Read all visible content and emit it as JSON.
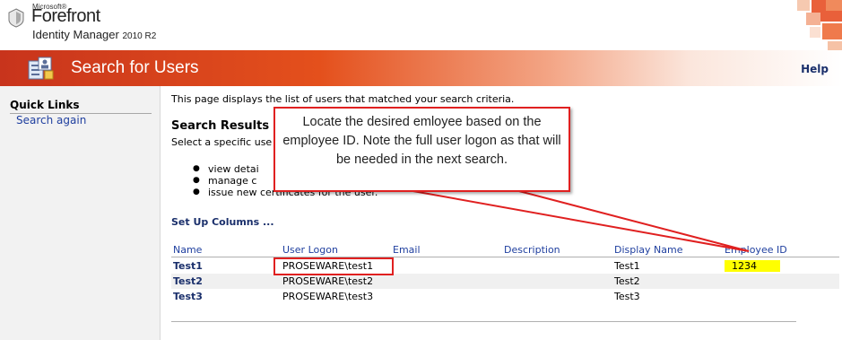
{
  "branding": {
    "microsoft": "Microsoft®",
    "product": "Forefront",
    "product_line": "Identity Manager",
    "version": "2010 R2"
  },
  "title_bar": {
    "title": "Search for Users",
    "help": "Help"
  },
  "sidebar": {
    "quick_links_title": "Quick Links",
    "links": [
      {
        "label": "Search again"
      }
    ]
  },
  "main": {
    "intro": "This page displays the list of users that matched your search criteria.",
    "results_heading": "Search Results",
    "results_instruction": "Select a specific use",
    "bullets": [
      "view detai",
      "manage c",
      "issue new certificates for the user."
    ],
    "setup_columns": "Set Up Columns ...",
    "table": {
      "columns": [
        "Name",
        "User Logon",
        "Email",
        "Description",
        "Display Name",
        "Employee ID"
      ],
      "rows": [
        {
          "name": "Test1",
          "user_logon": "PROSEWARE\\test1",
          "email": "",
          "description": "",
          "display_name": "Test1",
          "employee_id": "1234"
        },
        {
          "name": "Test2",
          "user_logon": "PROSEWARE\\test2",
          "email": "",
          "description": "",
          "display_name": "Test2",
          "employee_id": ""
        },
        {
          "name": "Test3",
          "user_logon": "PROSEWARE\\test3",
          "email": "",
          "description": "",
          "display_name": "Test3",
          "employee_id": ""
        }
      ]
    }
  },
  "annotation": {
    "callout_text": "Locate the desired emloyee based on the employee ID. Note the full user logon as that will be needed in the next search.",
    "color": "#e02020",
    "highlight_color": "#ffff00"
  },
  "colors": {
    "title_bar_start": "#c8341c",
    "title_bar_mid": "#e4501c",
    "link": "#1a2f6b",
    "column_header": "#1f3f9f"
  }
}
